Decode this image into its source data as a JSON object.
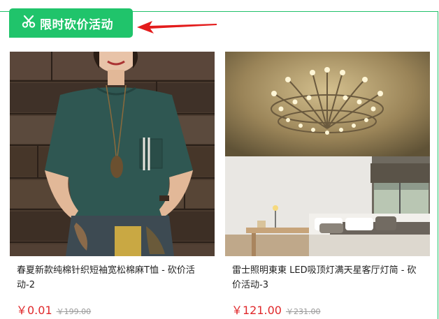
{
  "promo": {
    "title": "限时砍价活动",
    "icon": "scissors-icon",
    "accent_color": "#20c46b",
    "arrow_color": "#e31b1b"
  },
  "products": [
    {
      "title": "春夏新款纯棉针织短袖宽松棉麻T恤 - 砍价活动-2",
      "price": "￥0.01",
      "old_price": "￥199.00",
      "image": "woman-green-linen-shirt-photo"
    },
    {
      "title": "雷士照明東東 LED吸顶灯满天星客厅灯简 - 砍价活动-3",
      "price": "￥121.00",
      "old_price": "￥231.00",
      "image": "ceiling-chandelier-bedroom-photo"
    }
  ],
  "colors": {
    "price": "#e0282b",
    "old_price": "#9a9a9a"
  }
}
